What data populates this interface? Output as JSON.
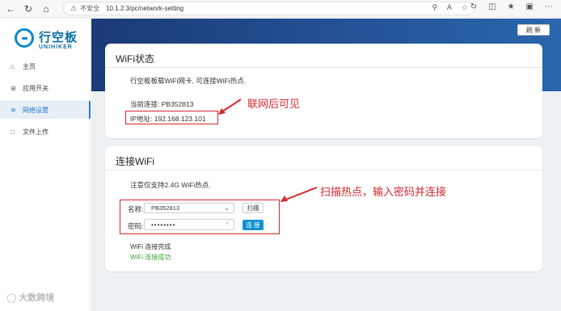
{
  "browser": {
    "insecure_label": "不安全",
    "url": "10.1.2.3/pc/network-setting"
  },
  "sidebar": {
    "logo_cn": "行空板",
    "logo_en": "UNIHIKER",
    "items": [
      {
        "label": "主页",
        "icon": "home-icon"
      },
      {
        "label": "应用开关",
        "icon": "grid-icon"
      },
      {
        "label": "网络设置",
        "icon": "wifi-icon",
        "active": true
      },
      {
        "label": "文件上传",
        "icon": "upload-icon"
      }
    ]
  },
  "header": {
    "refresh_label": "刷 新"
  },
  "wifi_status": {
    "title": "WiFi状态",
    "description": "行空板板载WiFi网卡, 可连接WiFi热点.",
    "current_connection": "当前连接: PB352813",
    "ip_address": "IP地址: 192.168.123.101"
  },
  "connect_wifi": {
    "title": "连接WiFi",
    "note": "注意仅支持2.4G WiFi热点.",
    "name_label": "名称:",
    "selected_ssid": "PB352813",
    "scan_label": "扫描",
    "password_label": "密码:",
    "password_value": "••••••••",
    "connect_label": "连 接",
    "status_line1": "WiFi 连接完成",
    "status_line2": "WiFi 连接成功"
  },
  "annotations": {
    "visible_after_connect": "联网后可见",
    "scan_and_connect": "扫描热点，输入密码并连接"
  },
  "watermark": "大数跨境",
  "colors": {
    "accent": "#1592d0",
    "annotation": "#d9262c",
    "success": "#3aa23a",
    "banner": "#1b3a78"
  }
}
